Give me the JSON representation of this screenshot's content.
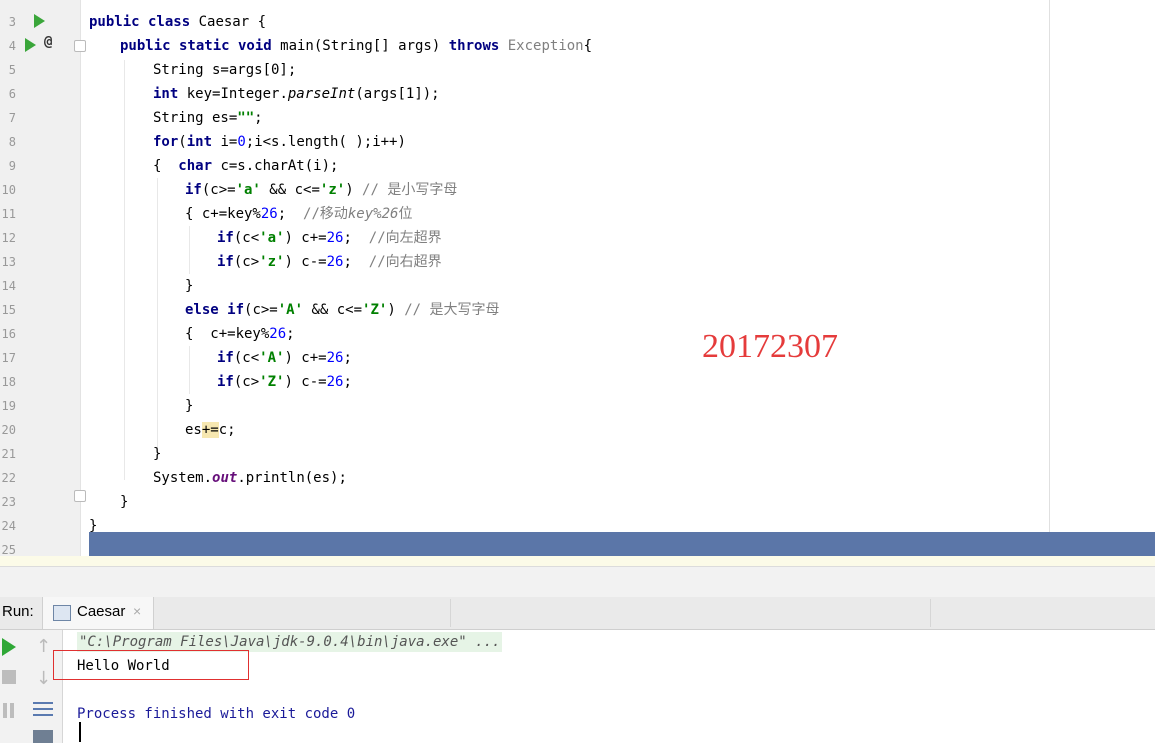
{
  "editor": {
    "line_numbers": [
      "3",
      "4",
      "5",
      "6",
      "7",
      "8",
      "9",
      "10",
      "11",
      "12",
      "13",
      "14",
      "15",
      "16",
      "17",
      "18",
      "19",
      "20",
      "21",
      "22",
      "23",
      "24",
      "25"
    ]
  },
  "code": {
    "l3": {
      "a": "public class",
      "b": " Caesar {"
    },
    "l4": {
      "kw1": "public static void",
      "b": " main(String[] args) ",
      "kw2": "throws",
      "exc": " Exception",
      "c": "{"
    },
    "l5": "String s=args[0];",
    "l6": {
      "kw": "int",
      "b": " key=Integer.",
      "m": "parseInt",
      "c": "(args[1]);"
    },
    "l7": {
      "a": "String es=",
      "s": "\"\"",
      "c": ";"
    },
    "l8": {
      "kw1": "for",
      "b": "(",
      "kw2": "int",
      "c": " i=",
      "n": "0",
      "d": ";i<s.length( );i++)"
    },
    "l9": {
      "a": "{  ",
      "kw": "char",
      "b": " c=s.charAt(i);"
    },
    "l10": {
      "kw": "if",
      "a": "(c>=",
      "s1": "'a'",
      "b": " && c<=",
      "s2": "'z'",
      "c": ") ",
      "cm": "// 是小写字母"
    },
    "l11": {
      "a": "{ c+=key%",
      "n": "26",
      "b": ";  ",
      "cm1": "//移动",
      "cm2": "key%26",
      "cm3": "位"
    },
    "l12": {
      "kw": "if",
      "a": "(c<",
      "s": "'a'",
      "b": ") c+=",
      "n": "26",
      "c": ";  ",
      "cm": "//向左超界"
    },
    "l13": {
      "kw": "if",
      "a": "(c>",
      "s": "'z'",
      "b": ") c-=",
      "n": "26",
      "c": ";  ",
      "cm": "//向右超界"
    },
    "l14": "}",
    "l15": {
      "kw1": "else",
      "sp": " ",
      "kw2": "if",
      "a": "(c>=",
      "s1": "'A'",
      "b": " && c<=",
      "s2": "'Z'",
      "c": ") ",
      "cm": "// 是大写字母"
    },
    "l16": {
      "a": "{  c+=key%",
      "n": "26",
      "b": ";"
    },
    "l17": {
      "kw": "if",
      "a": "(c<",
      "s": "'A'",
      "b": ") c+=",
      "n": "26",
      "c": ";"
    },
    "l18": {
      "kw": "if",
      "a": "(c>",
      "s": "'Z'",
      "b": ") c-=",
      "n": "26",
      "c": ";"
    },
    "l19": "}",
    "l20": {
      "a": "es",
      "h": "+=",
      "b": "c;"
    },
    "l21": "}",
    "l22": {
      "a": "System.",
      "f": "out",
      "b": ".println(es);"
    },
    "l23": "}",
    "l24": "}"
  },
  "watermark": "20172307",
  "run_panel": {
    "label": "Run:",
    "tab_name": "Caesar",
    "tab_close": "×"
  },
  "toolbar": {
    "up_arrow": "↑",
    "down_arrow": "↓"
  },
  "console": {
    "command": "\"C:\\Program Files\\Java\\jdk-9.0.4\\bin\\java.exe\" ...",
    "output": "Hello World",
    "exit_message": "Process finished with exit code 0"
  }
}
